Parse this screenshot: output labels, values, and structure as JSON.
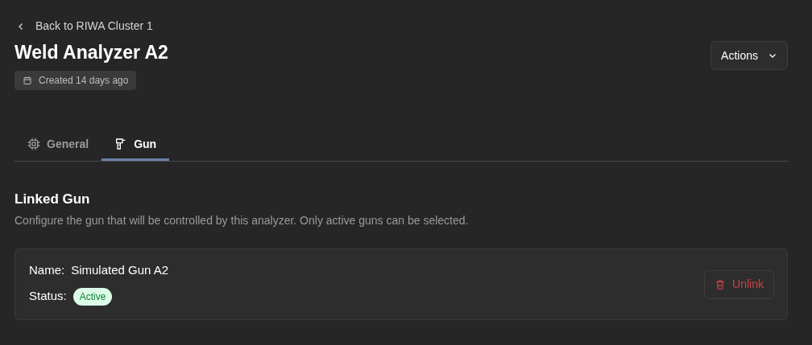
{
  "back_link": "Back to RIWA Cluster 1",
  "title": "Weld Analyzer A2",
  "created_badge": "Created 14 days ago",
  "actions_button": "Actions",
  "tabs": [
    {
      "label": "General",
      "kind": "chip",
      "selected": false
    },
    {
      "label": "Gun",
      "kind": "gun",
      "selected": true
    }
  ],
  "section": {
    "title": "Linked Gun",
    "description": "Configure the gun that will be controlled by this analyzer. Only active guns can be selected."
  },
  "gun_card": {
    "name_label": "Name:",
    "name": "Simulated Gun A2",
    "status_label": "Status:",
    "status": "Active",
    "status_active": true,
    "unlink_button": "Unlink"
  }
}
